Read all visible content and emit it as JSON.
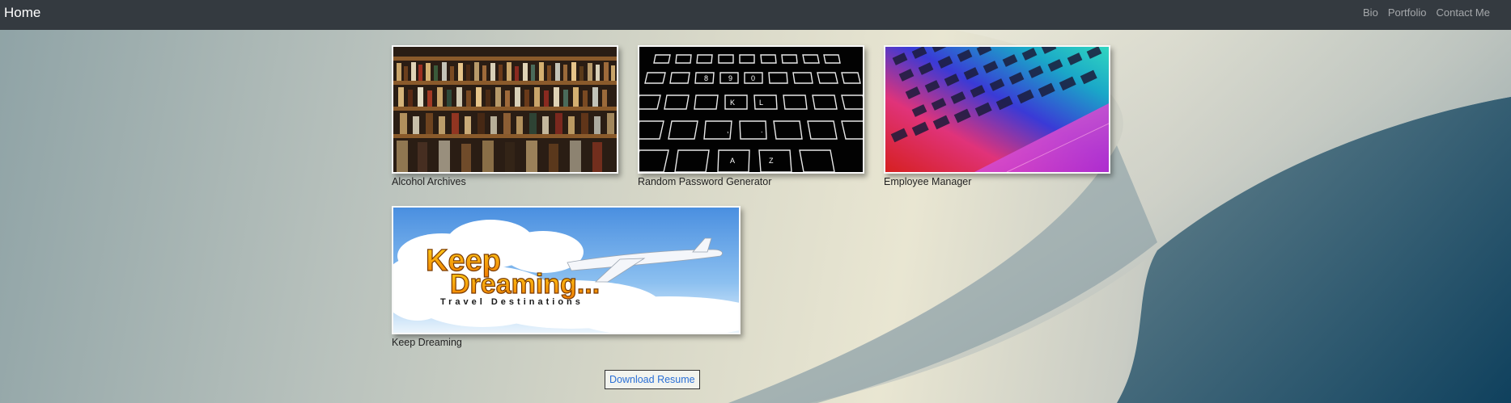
{
  "navbar": {
    "brand": "Home",
    "links": [
      "Bio",
      "Portfolio",
      "Contact Me"
    ]
  },
  "projects": [
    {
      "title": "Alcohol Archives",
      "image": "liquor-shelves-photo"
    },
    {
      "title": "Random Password Generator",
      "image": "backlit-keyboard-photo"
    },
    {
      "title": "Employee Manager",
      "image": "rainbow-laptop-keyboard-photo"
    },
    {
      "title": "Keep Dreaming",
      "image": "keep-dreaming-logo",
      "logo_line1": "Keep",
      "logo_line2": "Dreaming...",
      "logo_tagline": "Travel Destinations"
    }
  ],
  "download_resume_label": "Download Resume"
}
